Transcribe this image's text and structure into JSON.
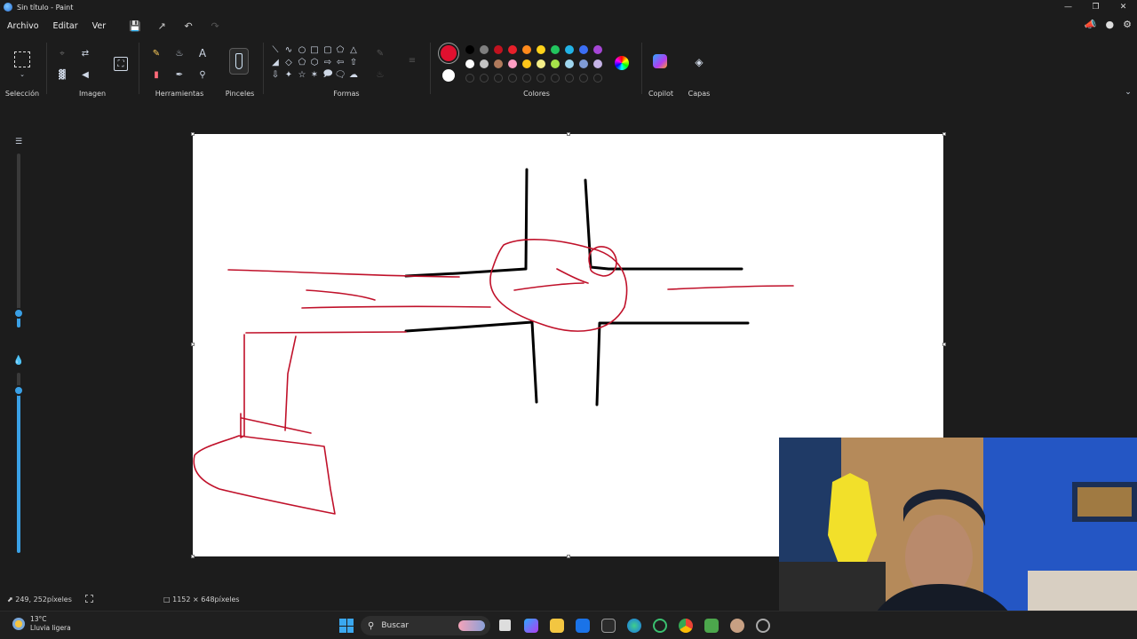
{
  "window": {
    "title": "Sin título - Paint",
    "controls": [
      "—",
      "❐",
      "✕"
    ]
  },
  "menu": {
    "items": [
      "Archivo",
      "Editar",
      "Ver"
    ]
  },
  "ribbon": {
    "groups": [
      {
        "label": "Selección"
      },
      {
        "label": "Imagen"
      },
      {
        "label": "Herramientas"
      },
      {
        "label": "Pinceles"
      },
      {
        "label": "Formas"
      },
      {
        "label": "Colores"
      },
      {
        "label": "Copilot"
      },
      {
        "label": "Capas"
      }
    ]
  },
  "colors": {
    "primary": "#e0102f",
    "secondary": "#ffffff",
    "palette_row1": [
      "#000000",
      "#7f7f7f",
      "#c1121f",
      "#e8202a",
      "#ff8a1c",
      "#ffd21a",
      "#22c55e",
      "#22b3e6",
      "#3b6ef5",
      "#a646d6"
    ],
    "palette_row2": [
      "#ffffff",
      "#c3c3c3",
      "#b07a5c",
      "#ff9ec4",
      "#ffc61a",
      "#f4ee88",
      "#a6e34a",
      "#9fd6ef",
      "#7f9bd6",
      "#c5b3e6"
    ]
  },
  "status": {
    "cursor_position": "249, 252píxeles",
    "canvas_size": "1152 × 648píxeles"
  },
  "taskbar": {
    "weather_temp": "13°C",
    "weather_desc": "Lluvia ligera",
    "search_placeholder": "Buscar"
  },
  "settings": {
    "brush_size_fraction": 0.08,
    "opacity_fraction": 0.9
  }
}
